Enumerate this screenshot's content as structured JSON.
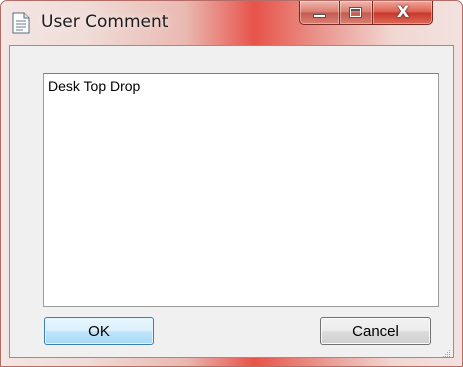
{
  "window": {
    "title": "User Comment",
    "title_icon": "notepad-document-icon",
    "caption_buttons": {
      "minimize_icon": "minimize-icon",
      "maximize_icon": "maximize-icon",
      "close_icon": "close-icon",
      "close_glyph": "X"
    }
  },
  "comment": {
    "value": "Desk Top Drop"
  },
  "buttons": {
    "ok_label": "OK",
    "cancel_label": "Cancel"
  },
  "colors": {
    "titlebar_accent": "#e7534a",
    "dialog_background": "#f0f0f0",
    "default_button_border": "#3c7fb1"
  }
}
